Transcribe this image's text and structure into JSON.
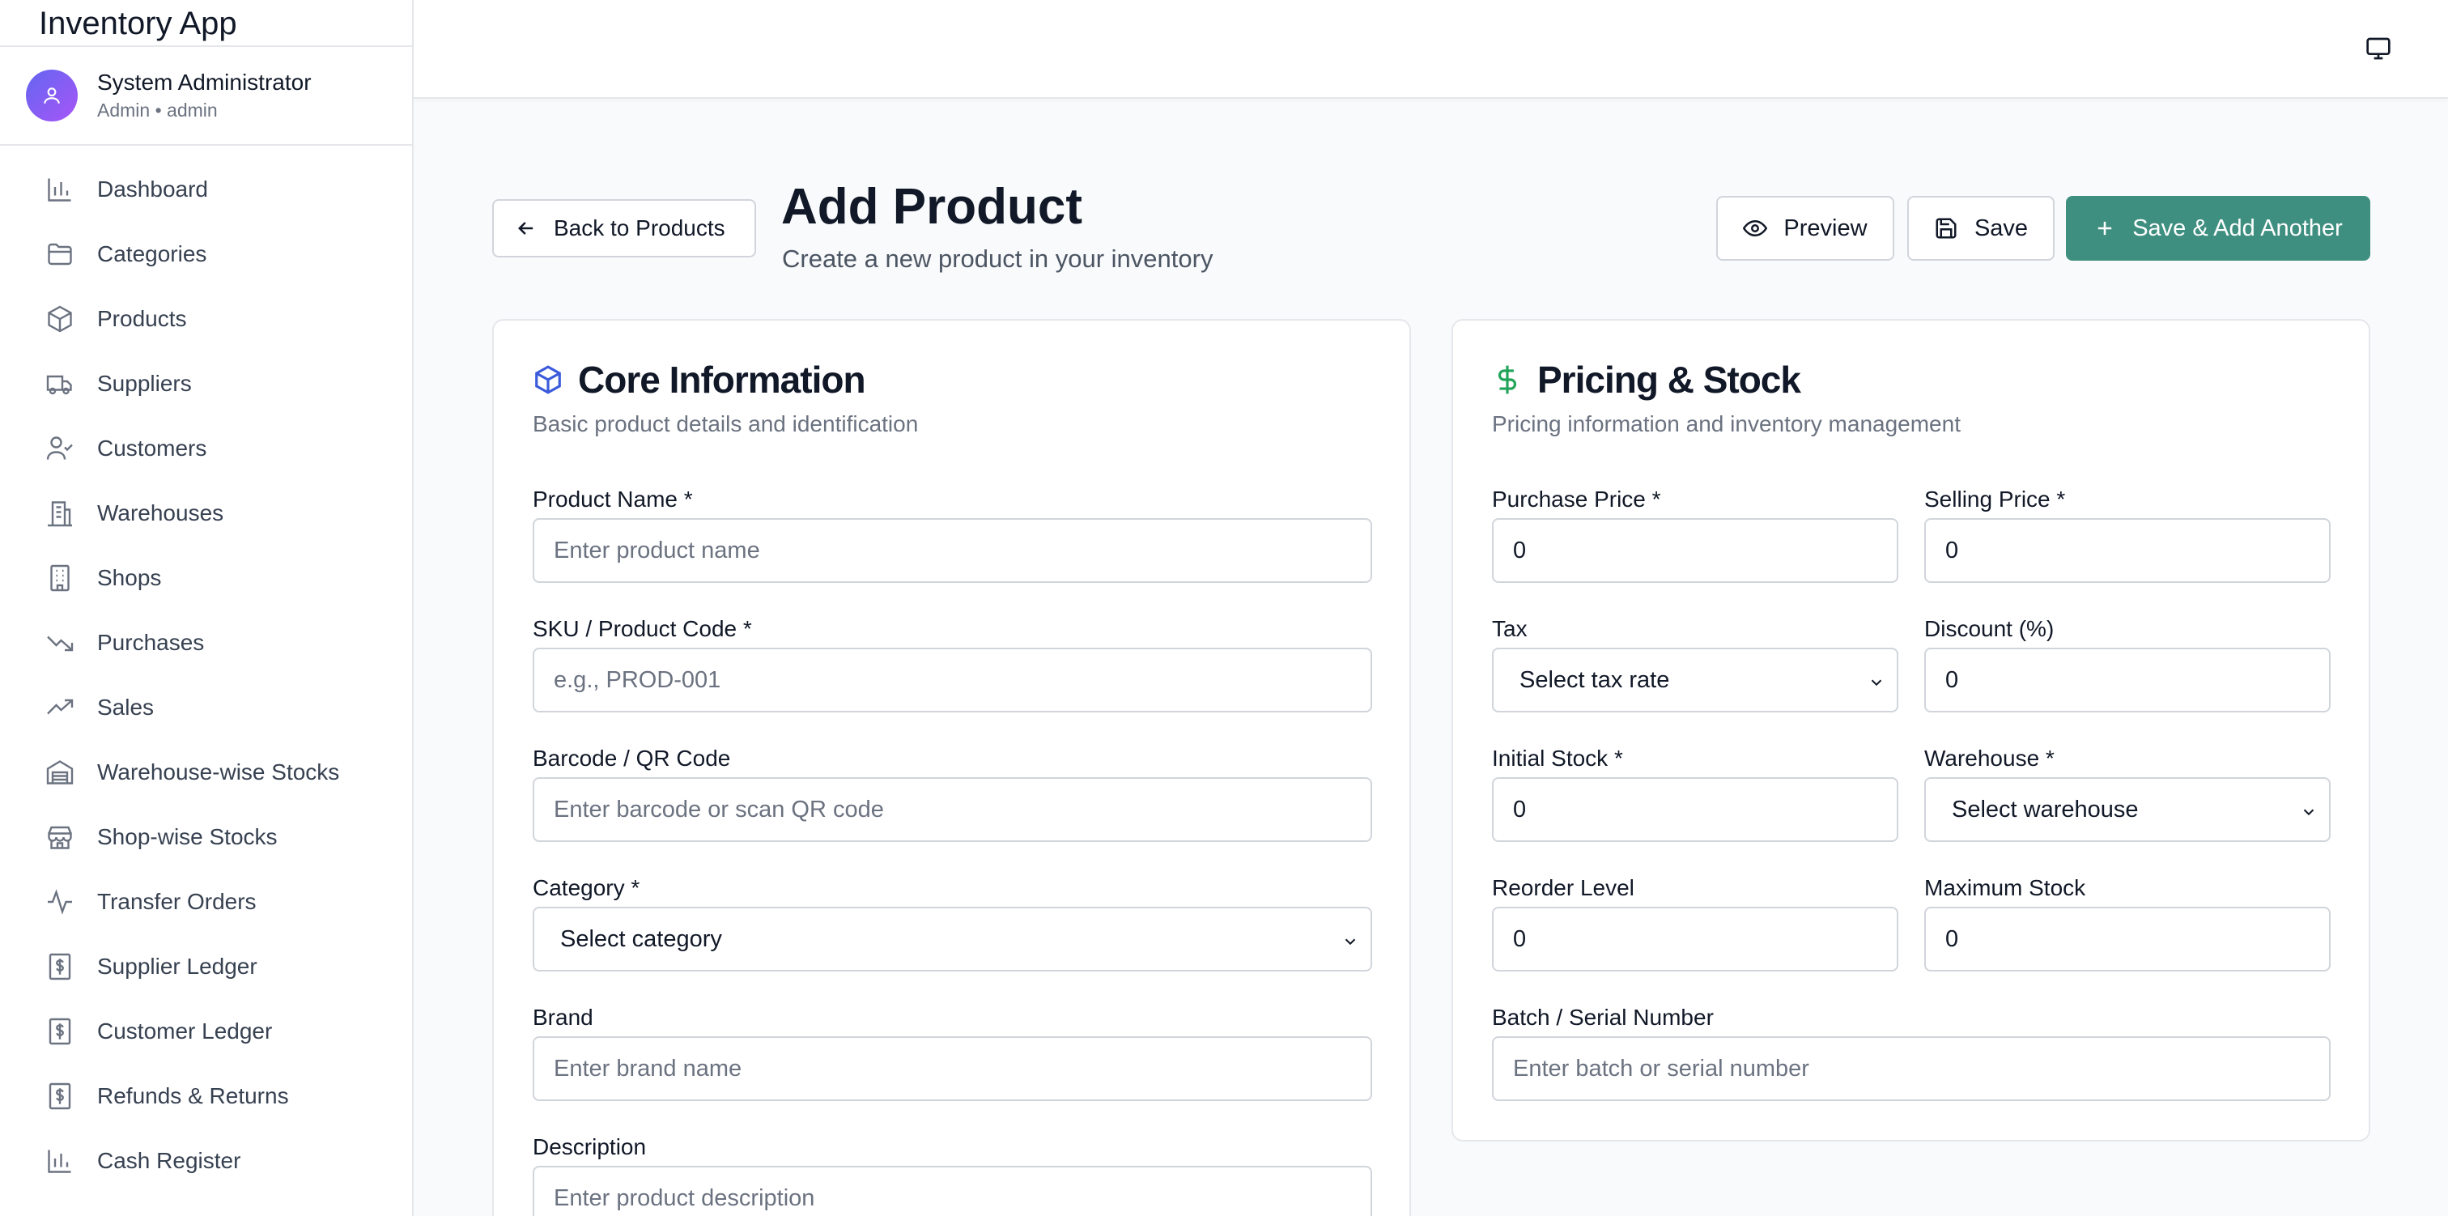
{
  "app": {
    "title": "Inventory App"
  },
  "user": {
    "name": "System Administrator",
    "role_line": "Admin • admin"
  },
  "sidebar": {
    "items": [
      {
        "label": "Dashboard",
        "icon": "bar-chart-icon"
      },
      {
        "label": "Categories",
        "icon": "folder-icon"
      },
      {
        "label": "Products",
        "icon": "package-icon"
      },
      {
        "label": "Suppliers",
        "icon": "truck-icon"
      },
      {
        "label": "Customers",
        "icon": "user-check-icon"
      },
      {
        "label": "Warehouses",
        "icon": "building-icon"
      },
      {
        "label": "Shops",
        "icon": "office-building-icon"
      },
      {
        "label": "Purchases",
        "icon": "trending-down-icon"
      },
      {
        "label": "Sales",
        "icon": "trending-up-icon"
      },
      {
        "label": "Warehouse-wise Stocks",
        "icon": "warehouse-icon"
      },
      {
        "label": "Shop-wise Stocks",
        "icon": "store-icon"
      },
      {
        "label": "Transfer Orders",
        "icon": "activity-icon"
      },
      {
        "label": "Supplier Ledger",
        "icon": "dollar-receipt-icon"
      },
      {
        "label": "Customer Ledger",
        "icon": "dollar-receipt-icon"
      },
      {
        "label": "Refunds & Returns",
        "icon": "dollar-receipt-icon"
      },
      {
        "label": "Cash Register",
        "icon": "bar-chart-icon"
      }
    ]
  },
  "header": {
    "back_label": "Back to Products",
    "title": "Add Product",
    "subtitle": "Create a new product in your inventory",
    "preview_label": "Preview",
    "save_label": "Save",
    "save_add_label": "Save & Add Another",
    "accent_color": "#3f8f80"
  },
  "core": {
    "title": "Core Information",
    "description": "Basic product details and identification",
    "product_name": {
      "label": "Product Name *",
      "placeholder": "Enter product name"
    },
    "sku": {
      "label": "SKU / Product Code *",
      "placeholder": "e.g., PROD-001"
    },
    "barcode": {
      "label": "Barcode / QR Code",
      "placeholder": "Enter barcode or scan QR code"
    },
    "category": {
      "label": "Category *",
      "value": "Select category"
    },
    "brand": {
      "label": "Brand",
      "placeholder": "Enter brand name"
    },
    "description_field": {
      "label": "Description",
      "placeholder": "Enter product description"
    }
  },
  "pricing": {
    "title": "Pricing & Stock",
    "description": "Pricing information and inventory management",
    "purchase_price": {
      "label": "Purchase Price *",
      "value": "0"
    },
    "selling_price": {
      "label": "Selling Price *",
      "value": "0"
    },
    "tax": {
      "label": "Tax",
      "value": "Select tax rate"
    },
    "discount": {
      "label": "Discount (%)",
      "value": "0"
    },
    "initial_stock": {
      "label": "Initial Stock *",
      "value": "0"
    },
    "warehouse": {
      "label": "Warehouse *",
      "value": "Select warehouse"
    },
    "reorder_level": {
      "label": "Reorder Level",
      "value": "0"
    },
    "maximum_stock": {
      "label": "Maximum Stock",
      "value": "0"
    },
    "batch": {
      "label": "Batch / Serial Number",
      "placeholder": "Enter batch or serial number"
    }
  }
}
